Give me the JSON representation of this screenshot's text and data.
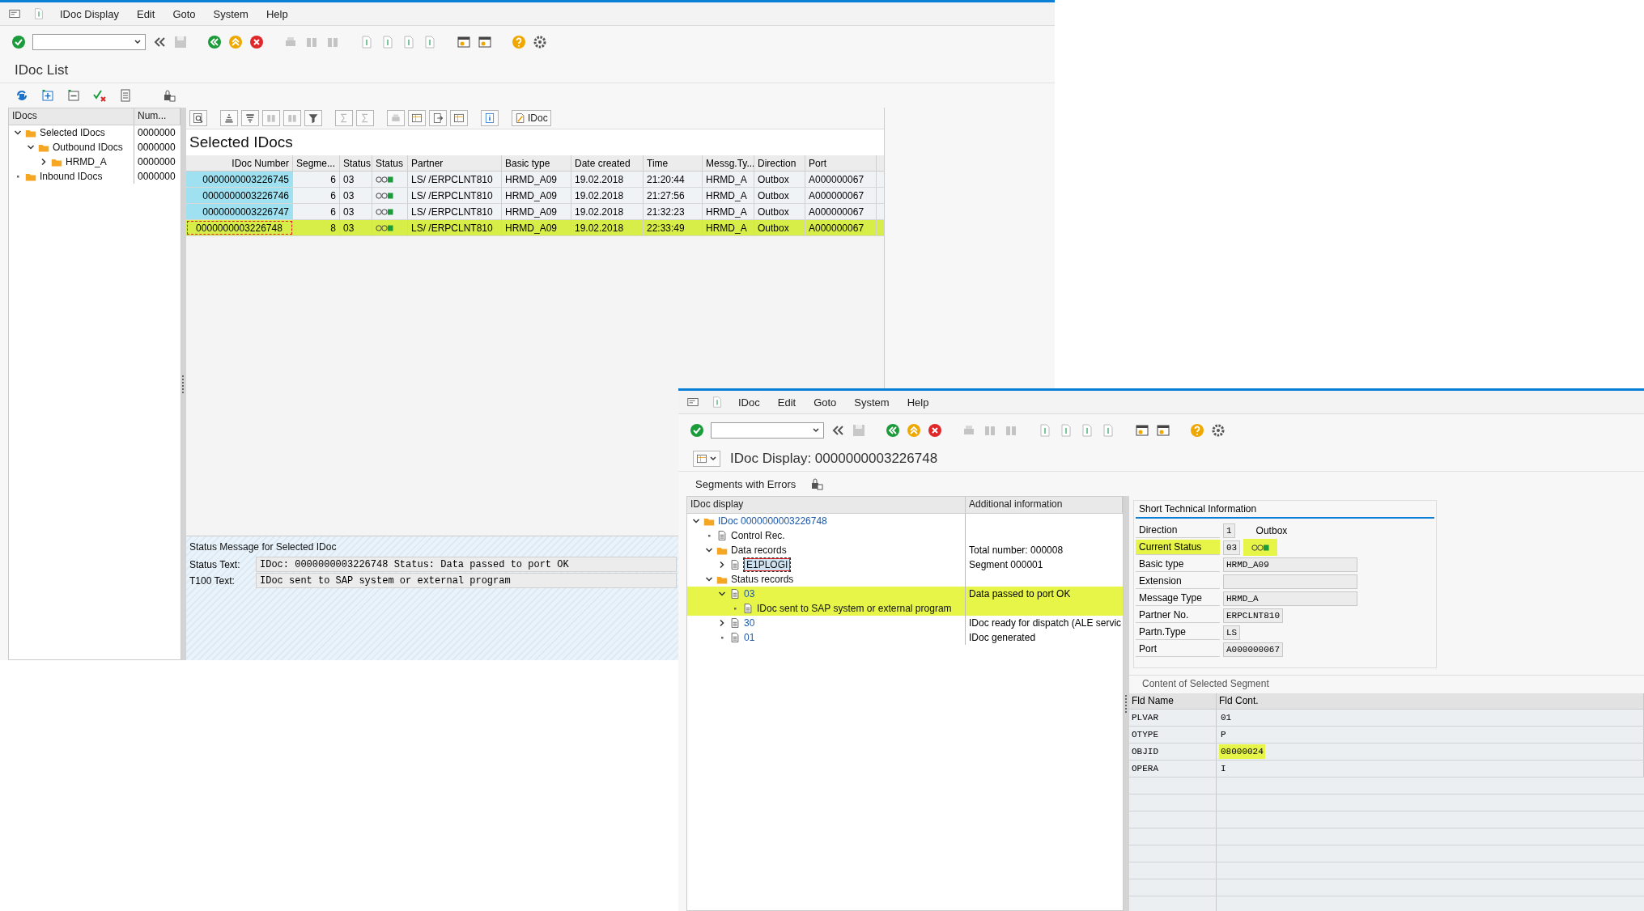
{
  "idoc_list_window": {
    "menu": [
      "IDoc Display",
      "Edit",
      "Goto",
      "System",
      "Help"
    ],
    "title": "IDoc List",
    "tree": {
      "columns": [
        "IDocs",
        "Num..."
      ],
      "items": [
        {
          "label": "Selected IDocs",
          "count": "0000000",
          "expanded": true,
          "leaf": false,
          "children": [
            {
              "label": "Outbound IDocs",
              "count": "0000000",
              "expanded": true,
              "leaf": false,
              "children": [
                {
                  "label": "HRMD_A",
                  "count": "0000000",
                  "expanded": false,
                  "leaf": false
                }
              ]
            }
          ]
        },
        {
          "label": "Inbound IDocs",
          "count": "0000000",
          "leaf": true
        }
      ]
    },
    "grid_button": "IDoc",
    "grid_title": "Selected IDocs",
    "table": {
      "columns": [
        "IDoc Number",
        "Segme...",
        "Status",
        "Status",
        "Partner",
        "Basic type",
        "Date created",
        "Time",
        "Messg.Ty...",
        "Direction",
        "Port"
      ],
      "rows": [
        {
          "selected": false,
          "cells": [
            "0000000003226745",
            "6",
            "03",
            "",
            "LS/  /ERPCLNT810",
            "HRMD_A09",
            "19.02.2018",
            "21:20:44",
            "HRMD_A",
            "Outbox",
            "A000000067"
          ]
        },
        {
          "selected": false,
          "cells": [
            "0000000003226746",
            "6",
            "03",
            "",
            "LS/  /ERPCLNT810",
            "HRMD_A09",
            "19.02.2018",
            "21:27:56",
            "HRMD_A",
            "Outbox",
            "A000000067"
          ]
        },
        {
          "selected": false,
          "cells": [
            "0000000003226747",
            "6",
            "03",
            "",
            "LS/  /ERPCLNT810",
            "HRMD_A09",
            "19.02.2018",
            "21:32:23",
            "HRMD_A",
            "Outbox",
            "A000000067"
          ]
        },
        {
          "selected": true,
          "cells": [
            "0000000003226748",
            "8",
            "03",
            "",
            "LS/  /ERPCLNT810",
            "HRMD_A09",
            "19.02.2018",
            "22:33:49",
            "HRMD_A",
            "Outbox",
            "A000000067"
          ]
        }
      ]
    },
    "status_message": {
      "title": "Status Message for Selected IDoc",
      "fields": [
        {
          "label": "Status Text:",
          "value": "IDoc: 0000000003226748 Status: Data passed to port OK"
        },
        {
          "label": "T100 Text:",
          "value": "IDoc sent to SAP system or external program"
        }
      ]
    }
  },
  "idoc_display_window": {
    "menu": [
      "IDoc",
      "Edit",
      "Goto",
      "System",
      "Help"
    ],
    "title": "IDoc Display: 0000000003226748",
    "app_button": "Segments with Errors",
    "tree": {
      "columns": [
        "IDoc display",
        "Additional information"
      ],
      "items": [
        {
          "label": "IDoc 0000000003226748",
          "kind": "folder",
          "expanded": true,
          "leaf": false,
          "link": true,
          "selected": false,
          "highlighted": false,
          "children": [
            {
              "label": "Control Rec.",
              "kind": "doc",
              "leaf": true,
              "link": false,
              "selected": false,
              "highlighted": false
            },
            {
              "label": "Data records",
              "kind": "folder",
              "expanded": true,
              "leaf": false,
              "link": false,
              "selected": false,
              "highlighted": false,
              "info": "Total number: 000008",
              "children": [
                {
                  "label": "E1PLOGI",
                  "kind": "doc",
                  "expanded": false,
                  "leaf": false,
                  "link": false,
                  "selected": true,
                  "highlighted": false,
                  "info": "Segment 000001"
                }
              ]
            },
            {
              "label": "Status records",
              "kind": "folder",
              "expanded": true,
              "leaf": false,
              "link": false,
              "selected": false,
              "highlighted": false,
              "children": [
                {
                  "label": "03",
                  "kind": "doc",
                  "expanded": true,
                  "leaf": false,
                  "link": true,
                  "selected": false,
                  "highlighted": true,
                  "info": "Data passed to port OK",
                  "children": [
                    {
                      "label": "IDoc sent to SAP system or external program",
                      "kind": "doc",
                      "leaf": true,
                      "link": false,
                      "selected": false,
                      "highlighted": true
                    }
                  ]
                },
                {
                  "label": "30",
                  "kind": "doc",
                  "expanded": false,
                  "leaf": false,
                  "link": true,
                  "selected": false,
                  "highlighted": false,
                  "info": "IDoc ready for dispatch (ALE servic"
                },
                {
                  "label": "01",
                  "kind": "doc",
                  "leaf": true,
                  "link": true,
                  "selected": false,
                  "highlighted": false,
                  "info": "IDoc generated"
                }
              ]
            }
          ]
        }
      ]
    },
    "tech_info": {
      "title": "Short Technical Information",
      "fields": [
        {
          "label": "Direction",
          "value": "1",
          "kind": "code",
          "note": "Outbox",
          "highlighted": false
        },
        {
          "label": "Current Status",
          "value": "03",
          "kind": "light",
          "highlighted": true
        },
        {
          "label": "Basic type",
          "value": "HRMD_A09",
          "kind": "wide",
          "highlighted": false
        },
        {
          "label": "Extension",
          "kind": "wide",
          "highlighted": false
        },
        {
          "label": "Message Type",
          "value": "HRMD_A",
          "kind": "wide",
          "highlighted": false
        },
        {
          "label": "Partner No.",
          "value": "ERPCLNT810",
          "kind": "medium",
          "highlighted": false
        },
        {
          "label": "Partn.Type",
          "value": "LS",
          "kind": "code",
          "highlighted": false
        },
        {
          "label": "Port",
          "value": "A000000067",
          "kind": "medium",
          "highlighted": false
        }
      ]
    },
    "segment": {
      "title": "Content of Selected Segment",
      "columns": [
        "Fld Name",
        "Fld Cont."
      ],
      "rows": [
        {
          "name": "PLVAR",
          "value": "01",
          "highlighted": false
        },
        {
          "name": "OTYPE",
          "value": "P",
          "highlighted": false
        },
        {
          "name": "OBJID",
          "value": "08000024",
          "highlighted": true
        },
        {
          "name": "OPERA",
          "value": "I",
          "highlighted": false
        }
      ]
    }
  }
}
